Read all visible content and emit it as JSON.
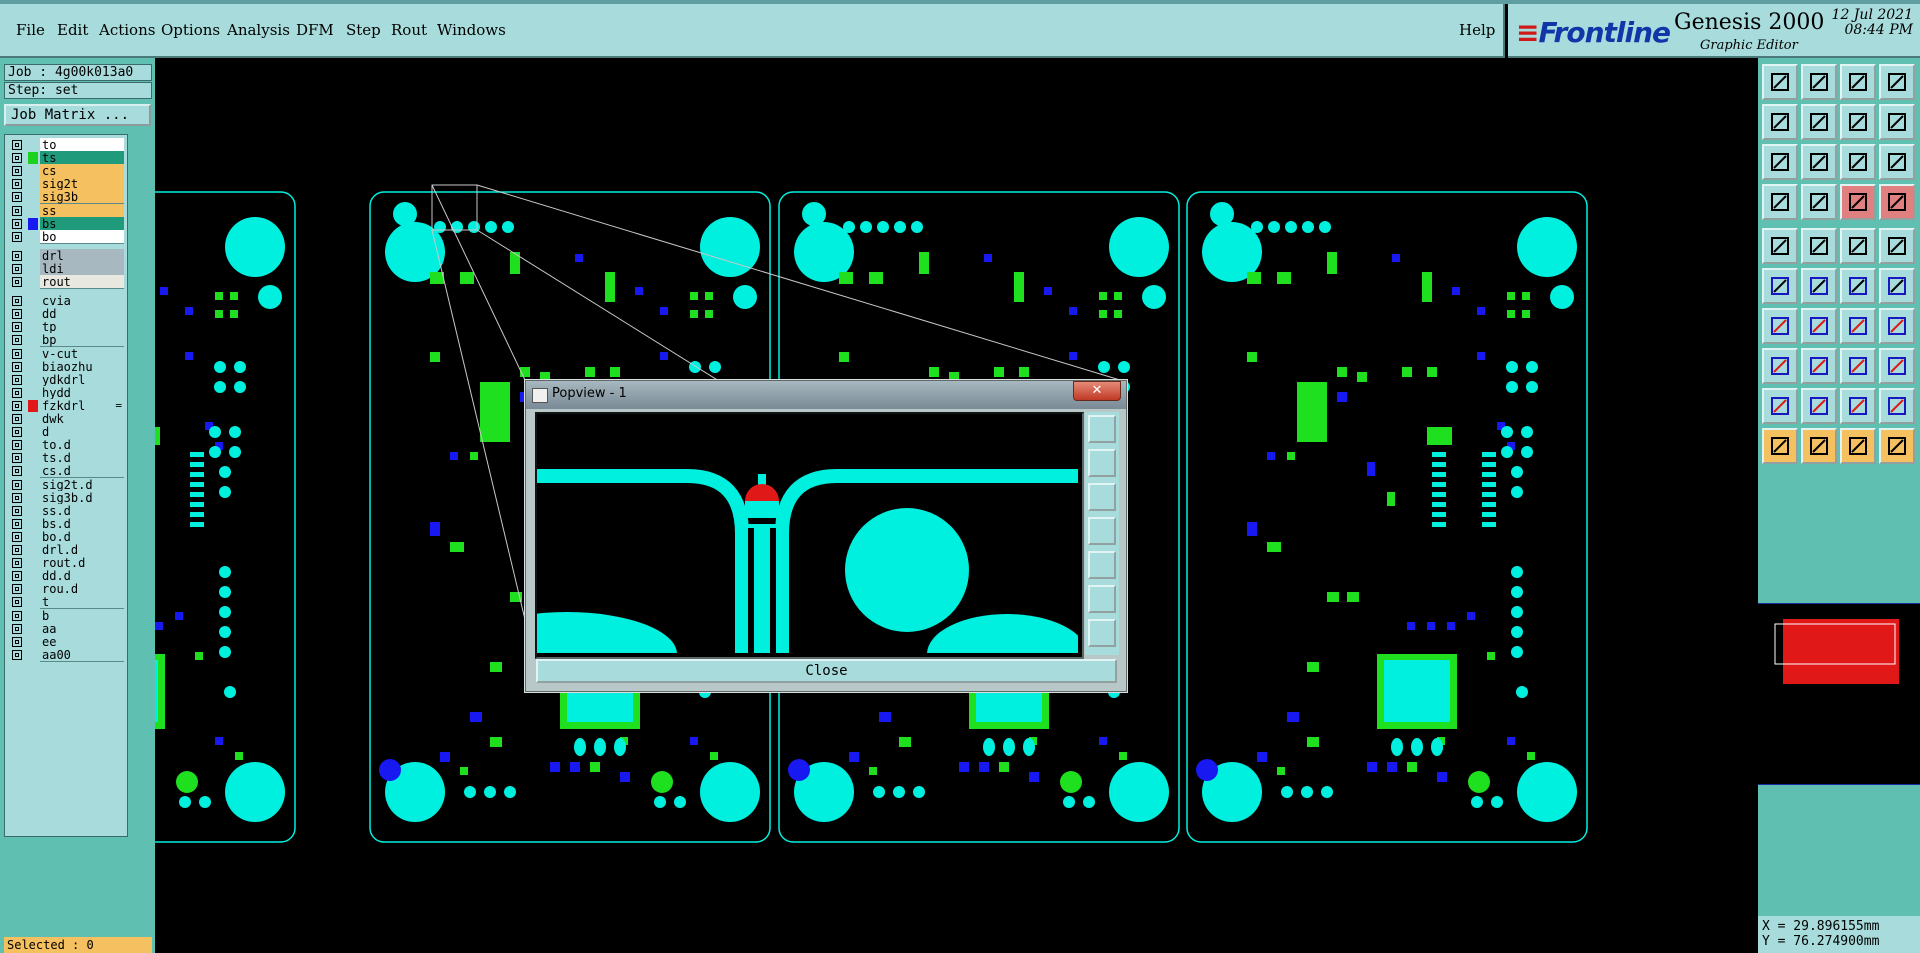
{
  "menu": {
    "items": [
      "File",
      "Edit",
      "Actions",
      "Options",
      "Analysis",
      "DFM",
      "Step",
      "Rout",
      "Windows"
    ],
    "help": "Help"
  },
  "brand": {
    "logo": "Frontline",
    "product": "Genesis 2000",
    "subtitle": "Graphic Editor",
    "date": "12 Jul 2021",
    "time": "08:44 PM"
  },
  "job": {
    "job_label": "Job : 4g00k013a0",
    "step_label": "Step: set",
    "job_matrix_button": "Job Matrix ..."
  },
  "layers": [
    {
      "name": "to",
      "swatch": "",
      "bg": "#ffffff"
    },
    {
      "name": "ts",
      "swatch": "#1fd11f",
      "bg": "#1f9a7a"
    },
    {
      "name": "cs",
      "swatch": "",
      "bg": "#f4c060"
    },
    {
      "name": "sig2t",
      "swatch": "",
      "bg": "#f4c060"
    },
    {
      "name": "sig3b",
      "swatch": "",
      "bg": "#f4c060"
    },
    {
      "name": "ss",
      "swatch": "",
      "bg": "#f4c060"
    },
    {
      "name": "bs",
      "swatch": "#1818f0",
      "bg": "#1f9a7a"
    },
    {
      "name": "bo",
      "swatch": "",
      "bg": "#ffffff"
    },
    {
      "name": "drl",
      "swatch": "",
      "bg": "#a8b8c0"
    },
    {
      "name": "ldi",
      "swatch": "",
      "bg": "#a8b8c0"
    },
    {
      "name": "rout",
      "swatch": "",
      "bg": "#e8e8e0"
    },
    {
      "name": "cvia",
      "swatch": "",
      "bg": "#a8dcdc"
    },
    {
      "name": "dd",
      "swatch": "",
      "bg": "#a8dcdc"
    },
    {
      "name": "tp",
      "swatch": "",
      "bg": "#a8dcdc"
    },
    {
      "name": "bp",
      "swatch": "",
      "bg": "#a8dcdc"
    },
    {
      "name": "v-cut",
      "swatch": "",
      "bg": "#a8dcdc"
    },
    {
      "name": "biaozhu",
      "swatch": "",
      "bg": "#a8dcdc"
    },
    {
      "name": "ydkdrl",
      "swatch": "",
      "bg": "#a8dcdc"
    },
    {
      "name": "hydd",
      "swatch": "",
      "bg": "#a8dcdc"
    },
    {
      "name": "fzkdrl",
      "swatch": "#e01818",
      "bg": "#a8dcdc",
      "mark": "="
    },
    {
      "name": "dwk",
      "swatch": "",
      "bg": "#a8dcdc"
    },
    {
      "name": "d",
      "swatch": "",
      "bg": "#a8dcdc"
    },
    {
      "name": "to.d",
      "swatch": "",
      "bg": "#a8dcdc"
    },
    {
      "name": "ts.d",
      "swatch": "",
      "bg": "#a8dcdc"
    },
    {
      "name": "cs.d",
      "swatch": "",
      "bg": "#a8dcdc"
    },
    {
      "name": "sig2t.d",
      "swatch": "",
      "bg": "#a8dcdc"
    },
    {
      "name": "sig3b.d",
      "swatch": "",
      "bg": "#a8dcdc"
    },
    {
      "name": "ss.d",
      "swatch": "",
      "bg": "#a8dcdc"
    },
    {
      "name": "bs.d",
      "swatch": "",
      "bg": "#a8dcdc"
    },
    {
      "name": "bo.d",
      "swatch": "",
      "bg": "#a8dcdc"
    },
    {
      "name": "drl.d",
      "swatch": "",
      "bg": "#a8dcdc"
    },
    {
      "name": "rout.d",
      "swatch": "",
      "bg": "#a8dcdc"
    },
    {
      "name": "dd.d",
      "swatch": "",
      "bg": "#a8dcdc"
    },
    {
      "name": "rou.d",
      "swatch": "",
      "bg": "#a8dcdc"
    },
    {
      "name": "t",
      "swatch": "",
      "bg": "#a8dcdc"
    },
    {
      "name": "b",
      "swatch": "",
      "bg": "#a8dcdc"
    },
    {
      "name": "aa",
      "swatch": "",
      "bg": "#a8dcdc"
    },
    {
      "name": "ee",
      "swatch": "",
      "bg": "#a8dcdc"
    },
    {
      "name": "aa00",
      "swatch": "",
      "bg": "#a8dcdc"
    }
  ],
  "status": {
    "selected": "Selected : 0",
    "x": "X = 29.896155mm",
    "y": "Y = 76.274900mm"
  },
  "popview": {
    "title": "Popview - 1",
    "close_x": "✕",
    "close_button": "Close"
  },
  "toolbar_icons": [
    "zoom-home-icon",
    "zoom-page-icon",
    "home-icon",
    "split-view-icon",
    "pan-left-icon",
    "pan-right-icon",
    "fit-icon",
    "redraw-icon",
    "zoom-in-icon",
    "zoom-out-icon",
    "scale-1-2-icon",
    "query-icon",
    "snap-icon",
    "measure-icon",
    "netlist-icon",
    "connect-icon",
    "pad-add-icon",
    "line-add-icon",
    "surface-icon",
    "feature-icon",
    "node-icon",
    "cross-icon",
    "line-node-icon",
    "arc-node-icon",
    "line-draw-icon",
    "line-edit-icon",
    "rotate-icon",
    "align-icon",
    "copy-icon",
    "split-icon",
    "resize-icon",
    "group-icon",
    "slot-icon",
    "arc-icon",
    "arc-edge-icon",
    "chord-icon",
    "select-icon",
    "select-area-icon",
    "select-net-icon",
    "select-link-icon"
  ],
  "colors": {
    "panel": "#a8dcdc",
    "panel_dark": "#5fbfb0",
    "copper": "#00f0e0",
    "mask": "#1fe01f",
    "blue": "#1818f0",
    "highlight": "#f4c060"
  }
}
